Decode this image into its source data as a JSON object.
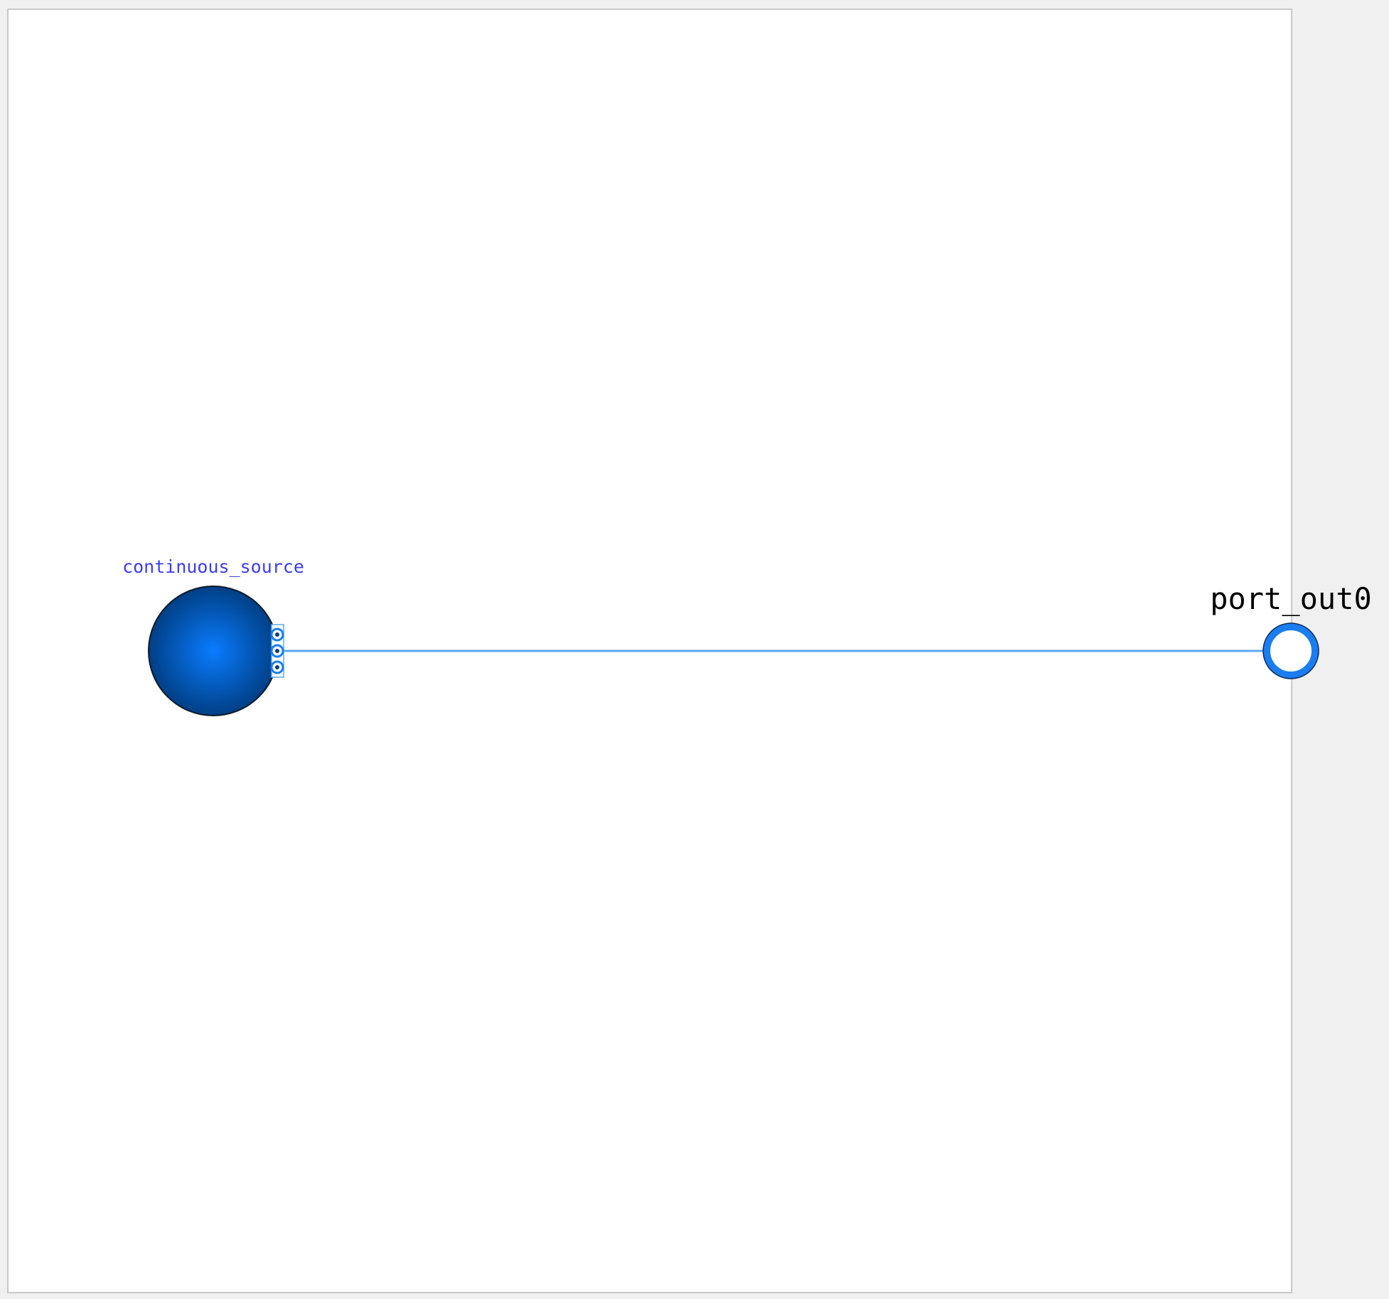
{
  "diagram": {
    "components": [
      {
        "id": "continuous_source",
        "label": "continuous_source",
        "shape": "circle",
        "label_color": "#3c3cf0",
        "fill_center": "#0a7cff",
        "fill_edge": "#003f85",
        "stroke": "#0d1b2a",
        "connector_count": 3
      }
    ],
    "ports": [
      {
        "id": "port_out0",
        "label": "port_out0",
        "direction": "output",
        "ring_color": "#1a7df0",
        "label_color": "#000000"
      }
    ],
    "connections": [
      {
        "from": "continuous_source",
        "to": "port_out0",
        "color": "#5aa8f0"
      }
    ]
  },
  "colors": {
    "background": "#f0f0f0",
    "canvas": "#ffffff",
    "canvas_border": "#c8c8c8",
    "connector": "#1a7df0"
  }
}
